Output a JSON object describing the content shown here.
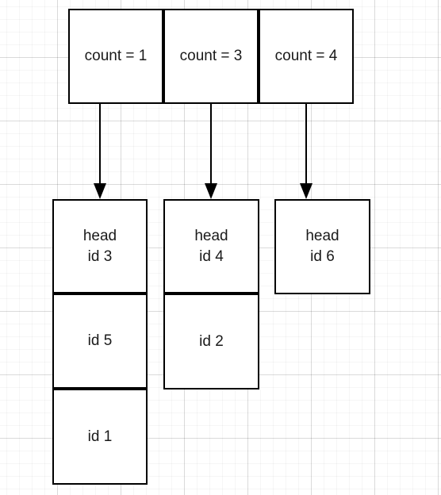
{
  "diagram": {
    "title": "hash-table-buckets-diagram",
    "stroke_color": "#000000",
    "text_color": "#1a1a1a",
    "background_color": "#ffffff",
    "top_row": {
      "name": "bucket-count-row",
      "cells": [
        {
          "label": "count = 1",
          "count": 1
        },
        {
          "label": "count = 3",
          "count": 3
        },
        {
          "label": "count = 4",
          "count": 4
        }
      ]
    },
    "arrows": [
      {
        "name": "arrow-bucket-0",
        "from": "count = 1",
        "to": "head id 3"
      },
      {
        "name": "arrow-bucket-1",
        "from": "count = 3",
        "to": "head id 4"
      },
      {
        "name": "arrow-bucket-2",
        "from": "count = 4",
        "to": "head id 6"
      }
    ],
    "columns": [
      {
        "name": "chain-column-0",
        "nodes": [
          {
            "line1": "head",
            "line2": "id 3"
          },
          {
            "line1": "",
            "line2": "id 5"
          },
          {
            "line1": "",
            "line2": "id 1"
          }
        ]
      },
      {
        "name": "chain-column-1",
        "nodes": [
          {
            "line1": "head",
            "line2": "id 4"
          },
          {
            "line1": "",
            "line2": "id 2"
          }
        ]
      },
      {
        "name": "chain-column-2",
        "nodes": [
          {
            "line1": "head",
            "line2": "id 6"
          }
        ]
      }
    ]
  }
}
